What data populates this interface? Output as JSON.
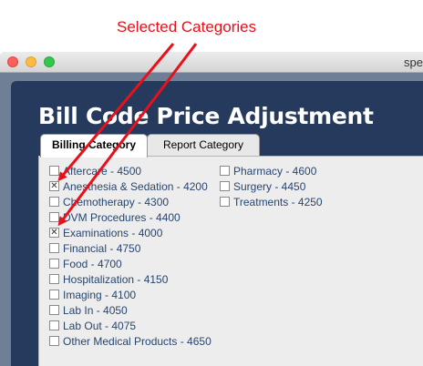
{
  "annotation": {
    "label": "Selected Categories"
  },
  "window": {
    "title": "spe"
  },
  "page": {
    "title": "Bill Code Price Adjustment"
  },
  "tabs": [
    {
      "label": "Billing Category",
      "active": true
    },
    {
      "label": "Report Category",
      "active": false
    }
  ],
  "categories": {
    "col1": [
      {
        "label": "Aftercare - 4500",
        "checked": false
      },
      {
        "label": "Anesthesia & Sedation - 4200",
        "checked": true
      },
      {
        "label": "Chemotherapy - 4300",
        "checked": false
      },
      {
        "label": "DVM Procedures - 4400",
        "checked": false
      },
      {
        "label": "Examinations - 4000",
        "checked": true
      },
      {
        "label": "Financial - 4750",
        "checked": false
      },
      {
        "label": "Food - 4700",
        "checked": false
      },
      {
        "label": "Hospitalization - 4150",
        "checked": false
      },
      {
        "label": "Imaging - 4100",
        "checked": false
      },
      {
        "label": "Lab In - 4050",
        "checked": false
      },
      {
        "label": "Lab Out - 4075",
        "checked": false
      },
      {
        "label": "Other Medical Products - 4650",
        "checked": false
      }
    ],
    "col2": [
      {
        "label": "Pharmacy - 4600",
        "checked": false
      },
      {
        "label": "Surgery - 4450",
        "checked": false
      },
      {
        "label": "Treatments - 4250",
        "checked": false
      }
    ]
  },
  "colors": {
    "annotation": "#e8101a",
    "link_text": "#27466f",
    "panel": "#253a5c"
  }
}
